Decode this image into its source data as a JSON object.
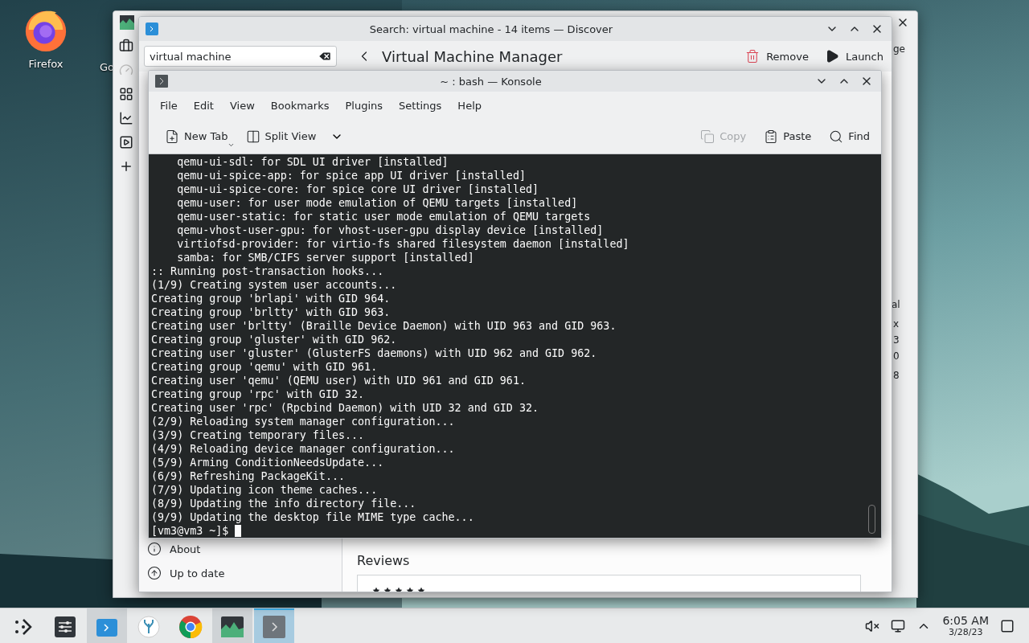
{
  "desktop": {
    "icons": [
      {
        "label": "Firefox",
        "kind": "firefox"
      },
      {
        "label": "Go",
        "kind": "other"
      }
    ]
  },
  "back_window": {
    "fragments": [
      "ge",
      "al",
      "x",
      "3",
      "0",
      "8"
    ]
  },
  "discover": {
    "title": "Search: virtual machine - 14 items — Discover",
    "search": {
      "value": "virtual machine"
    },
    "page_title": "Virtual Machine Manager",
    "actions": [
      {
        "label": "Remove",
        "kind": "remove"
      },
      {
        "label": "Launch",
        "kind": "launch"
      }
    ],
    "sidebar": [
      {
        "label": "About",
        "kind": "about"
      },
      {
        "label": "Up to date",
        "kind": "update"
      }
    ],
    "reviews_heading": "Reviews"
  },
  "konsole": {
    "title": "~ : bash — Konsole",
    "menu": [
      "File",
      "Edit",
      "View",
      "Bookmarks",
      "Plugins",
      "Settings",
      "Help"
    ],
    "toolbar": [
      {
        "label": "New Tab",
        "kind": "newtab",
        "disabled": false
      },
      {
        "label": "Split View",
        "kind": "split",
        "disabled": false
      },
      {
        "label": "Copy",
        "kind": "copy",
        "disabled": true
      },
      {
        "label": "Paste",
        "kind": "paste",
        "disabled": false
      },
      {
        "label": "Find",
        "kind": "find",
        "disabled": false
      }
    ],
    "lines": [
      "    qemu-ui-sdl: for SDL UI driver [installed]",
      "    qemu-ui-spice-app: for spice app UI driver [installed]",
      "    qemu-ui-spice-core: for spice core UI driver [installed]",
      "    qemu-user: for user mode emulation of QEMU targets [installed]",
      "    qemu-user-static: for static user mode emulation of QEMU targets",
      "    qemu-vhost-user-gpu: for vhost-user-gpu display device [installed]",
      "    virtiofsd-provider: for virtio-fs shared filesystem daemon [installed]",
      "    samba: for SMB/CIFS server support [installed]",
      ":: Running post-transaction hooks...",
      "(1/9) Creating system user accounts...",
      "Creating group 'brlapi' with GID 964.",
      "Creating group 'brltty' with GID 963.",
      "Creating user 'brltty' (Braille Device Daemon) with UID 963 and GID 963.",
      "Creating group 'gluster' with GID 962.",
      "Creating user 'gluster' (GlusterFS daemons) with UID 962 and GID 962.",
      "Creating group 'qemu' with GID 961.",
      "Creating user 'qemu' (QEMU user) with UID 961 and GID 961.",
      "Creating group 'rpc' with GID 32.",
      "Creating user 'rpc' (Rpcbind Daemon) with UID 32 and GID 32.",
      "(2/9) Reloading system manager configuration...",
      "(3/9) Creating temporary files...",
      "(4/9) Reloading device manager configuration...",
      "(5/9) Arming ConditionNeedsUpdate...",
      "(6/9) Refreshing PackageKit...",
      "(7/9) Updating icon theme caches...",
      "(8/9) Updating the info directory file...",
      "(9/9) Updating the desktop file MIME type cache..."
    ],
    "prompt": "[vm3@vm3 ~]$"
  },
  "taskbar": {
    "items": [
      {
        "kind": "launcher",
        "open": false,
        "selected": false
      },
      {
        "kind": "settings",
        "open": false,
        "selected": false
      },
      {
        "kind": "discover",
        "open": true,
        "selected": false
      },
      {
        "kind": "codium",
        "open": false,
        "selected": false
      },
      {
        "kind": "chrome",
        "open": false,
        "selected": false
      },
      {
        "kind": "monitor",
        "open": true,
        "selected": false
      },
      {
        "kind": "konsole",
        "open": true,
        "selected": true
      }
    ],
    "clock": {
      "time": "6:05 AM",
      "date": "3/28/23"
    }
  }
}
